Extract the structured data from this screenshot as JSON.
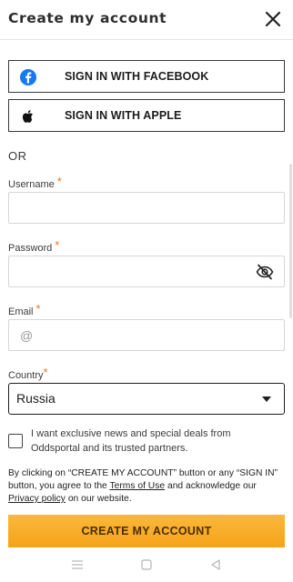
{
  "header": {
    "title": "Create my account",
    "close_icon": "close-icon"
  },
  "social": {
    "facebook_label": "SIGN IN WITH FACEBOOK",
    "apple_label": "SIGN IN WITH APPLE",
    "facebook_color": "#1877f2"
  },
  "or_text": "OR",
  "form": {
    "username": {
      "label": "Username",
      "required": "*",
      "value": "",
      "placeholder": ""
    },
    "password": {
      "label": "Password",
      "required": "*",
      "value": "",
      "placeholder": ""
    },
    "email": {
      "label": "Email",
      "required": "*",
      "value": "",
      "placeholder": "@"
    },
    "country": {
      "label": "Country",
      "required": "*",
      "selected": "Russia"
    }
  },
  "newsletter": {
    "checked": false,
    "text": "I want exclusive news and special deals from Oddsportal and its trusted partners."
  },
  "terms": {
    "prefix": "By clicking on “CREATE MY ACCOUNT” button or any “SIGN IN” button, you agree to the ",
    "terms_link": "Terms of Use",
    "middle": " and acknowledge our ",
    "privacy_link": "Privacy policy",
    "suffix": " on our website."
  },
  "create_button": {
    "label": "CREATE MY ACCOUNT",
    "color": "#f7a823"
  },
  "accent_color": "#e87722",
  "system_nav": {
    "icons": [
      "menu-icon",
      "home-square-icon",
      "back-triangle-icon"
    ]
  }
}
